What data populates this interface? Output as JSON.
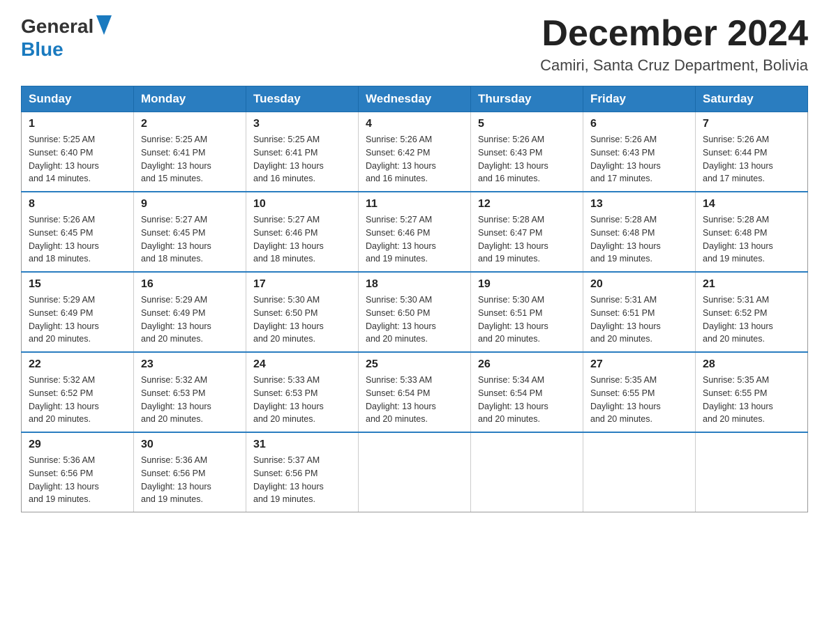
{
  "header": {
    "logo_general": "General",
    "logo_blue": "Blue",
    "month_title": "December 2024",
    "location": "Camiri, Santa Cruz Department, Bolivia"
  },
  "weekdays": [
    "Sunday",
    "Monday",
    "Tuesday",
    "Wednesday",
    "Thursday",
    "Friday",
    "Saturday"
  ],
  "weeks": [
    [
      {
        "day": "1",
        "sunrise": "5:25 AM",
        "sunset": "6:40 PM",
        "daylight": "13 hours and 14 minutes."
      },
      {
        "day": "2",
        "sunrise": "5:25 AM",
        "sunset": "6:41 PM",
        "daylight": "13 hours and 15 minutes."
      },
      {
        "day": "3",
        "sunrise": "5:25 AM",
        "sunset": "6:41 PM",
        "daylight": "13 hours and 16 minutes."
      },
      {
        "day": "4",
        "sunrise": "5:26 AM",
        "sunset": "6:42 PM",
        "daylight": "13 hours and 16 minutes."
      },
      {
        "day": "5",
        "sunrise": "5:26 AM",
        "sunset": "6:43 PM",
        "daylight": "13 hours and 16 minutes."
      },
      {
        "day": "6",
        "sunrise": "5:26 AM",
        "sunset": "6:43 PM",
        "daylight": "13 hours and 17 minutes."
      },
      {
        "day": "7",
        "sunrise": "5:26 AM",
        "sunset": "6:44 PM",
        "daylight": "13 hours and 17 minutes."
      }
    ],
    [
      {
        "day": "8",
        "sunrise": "5:26 AM",
        "sunset": "6:45 PM",
        "daylight": "13 hours and 18 minutes."
      },
      {
        "day": "9",
        "sunrise": "5:27 AM",
        "sunset": "6:45 PM",
        "daylight": "13 hours and 18 minutes."
      },
      {
        "day": "10",
        "sunrise": "5:27 AM",
        "sunset": "6:46 PM",
        "daylight": "13 hours and 18 minutes."
      },
      {
        "day": "11",
        "sunrise": "5:27 AM",
        "sunset": "6:46 PM",
        "daylight": "13 hours and 19 minutes."
      },
      {
        "day": "12",
        "sunrise": "5:28 AM",
        "sunset": "6:47 PM",
        "daylight": "13 hours and 19 minutes."
      },
      {
        "day": "13",
        "sunrise": "5:28 AM",
        "sunset": "6:48 PM",
        "daylight": "13 hours and 19 minutes."
      },
      {
        "day": "14",
        "sunrise": "5:28 AM",
        "sunset": "6:48 PM",
        "daylight": "13 hours and 19 minutes."
      }
    ],
    [
      {
        "day": "15",
        "sunrise": "5:29 AM",
        "sunset": "6:49 PM",
        "daylight": "13 hours and 20 minutes."
      },
      {
        "day": "16",
        "sunrise": "5:29 AM",
        "sunset": "6:49 PM",
        "daylight": "13 hours and 20 minutes."
      },
      {
        "day": "17",
        "sunrise": "5:30 AM",
        "sunset": "6:50 PM",
        "daylight": "13 hours and 20 minutes."
      },
      {
        "day": "18",
        "sunrise": "5:30 AM",
        "sunset": "6:50 PM",
        "daylight": "13 hours and 20 minutes."
      },
      {
        "day": "19",
        "sunrise": "5:30 AM",
        "sunset": "6:51 PM",
        "daylight": "13 hours and 20 minutes."
      },
      {
        "day": "20",
        "sunrise": "5:31 AM",
        "sunset": "6:51 PM",
        "daylight": "13 hours and 20 minutes."
      },
      {
        "day": "21",
        "sunrise": "5:31 AM",
        "sunset": "6:52 PM",
        "daylight": "13 hours and 20 minutes."
      }
    ],
    [
      {
        "day": "22",
        "sunrise": "5:32 AM",
        "sunset": "6:52 PM",
        "daylight": "13 hours and 20 minutes."
      },
      {
        "day": "23",
        "sunrise": "5:32 AM",
        "sunset": "6:53 PM",
        "daylight": "13 hours and 20 minutes."
      },
      {
        "day": "24",
        "sunrise": "5:33 AM",
        "sunset": "6:53 PM",
        "daylight": "13 hours and 20 minutes."
      },
      {
        "day": "25",
        "sunrise": "5:33 AM",
        "sunset": "6:54 PM",
        "daylight": "13 hours and 20 minutes."
      },
      {
        "day": "26",
        "sunrise": "5:34 AM",
        "sunset": "6:54 PM",
        "daylight": "13 hours and 20 minutes."
      },
      {
        "day": "27",
        "sunrise": "5:35 AM",
        "sunset": "6:55 PM",
        "daylight": "13 hours and 20 minutes."
      },
      {
        "day": "28",
        "sunrise": "5:35 AM",
        "sunset": "6:55 PM",
        "daylight": "13 hours and 20 minutes."
      }
    ],
    [
      {
        "day": "29",
        "sunrise": "5:36 AM",
        "sunset": "6:56 PM",
        "daylight": "13 hours and 19 minutes."
      },
      {
        "day": "30",
        "sunrise": "5:36 AM",
        "sunset": "6:56 PM",
        "daylight": "13 hours and 19 minutes."
      },
      {
        "day": "31",
        "sunrise": "5:37 AM",
        "sunset": "6:56 PM",
        "daylight": "13 hours and 19 minutes."
      },
      null,
      null,
      null,
      null
    ]
  ],
  "labels": {
    "sunrise": "Sunrise:",
    "sunset": "Sunset:",
    "daylight": "Daylight:"
  }
}
